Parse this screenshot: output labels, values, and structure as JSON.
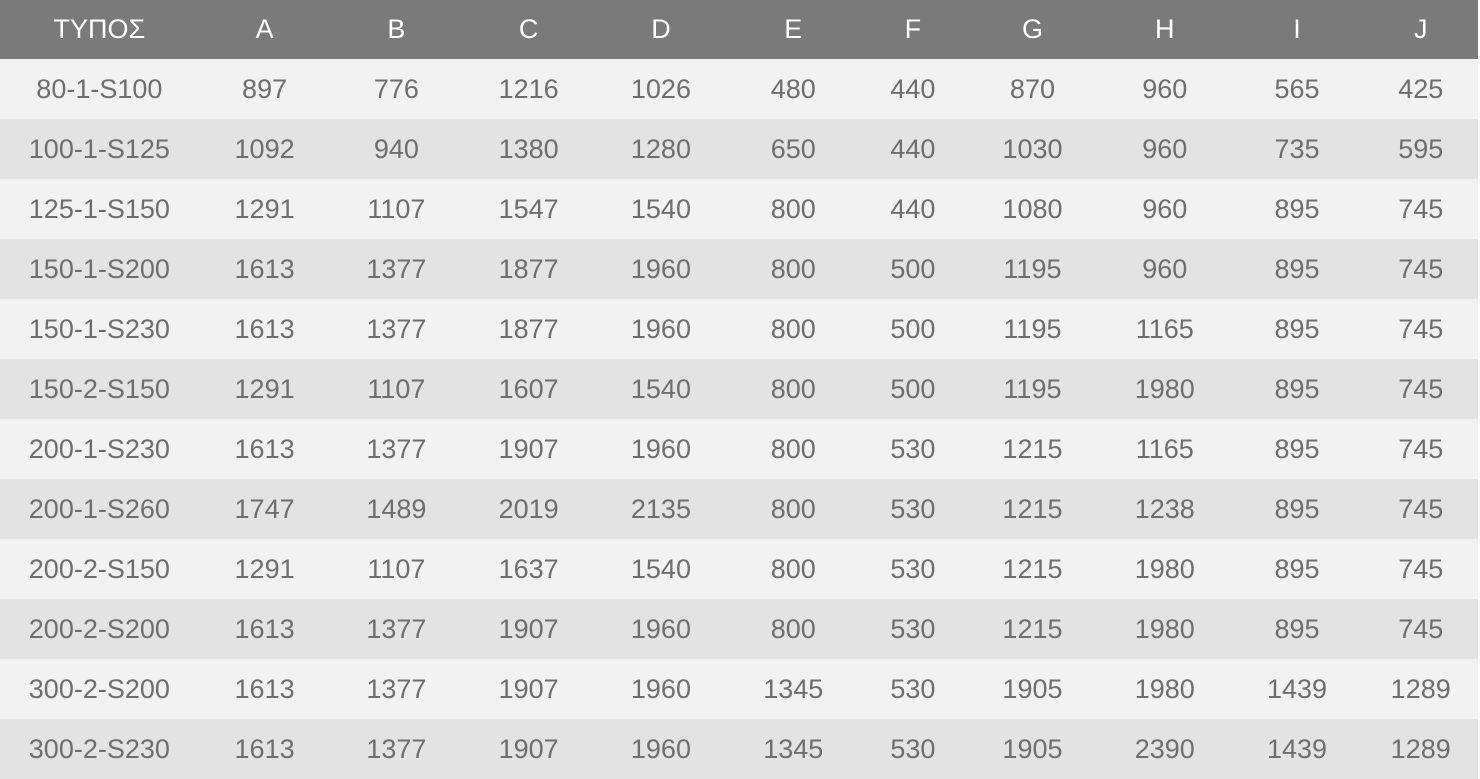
{
  "table": {
    "headers": [
      "ΤΥΠΟΣ",
      "A",
      "B",
      "C",
      "D",
      "E",
      "F",
      "G",
      "H",
      "I",
      "J"
    ],
    "rows": [
      [
        "80-1-S100",
        "897",
        "776",
        "1216",
        "1026",
        "480",
        "440",
        "870",
        "960",
        "565",
        "425"
      ],
      [
        "100-1-S125",
        "1092",
        "940",
        "1380",
        "1280",
        "650",
        "440",
        "1030",
        "960",
        "735",
        "595"
      ],
      [
        "125-1-S150",
        "1291",
        "1107",
        "1547",
        "1540",
        "800",
        "440",
        "1080",
        "960",
        "895",
        "745"
      ],
      [
        "150-1-S200",
        "1613",
        "1377",
        "1877",
        "1960",
        "800",
        "500",
        "1195",
        "960",
        "895",
        "745"
      ],
      [
        "150-1-S230",
        "1613",
        "1377",
        "1877",
        "1960",
        "800",
        "500",
        "1195",
        "1165",
        "895",
        "745"
      ],
      [
        "150-2-S150",
        "1291",
        "1107",
        "1607",
        "1540",
        "800",
        "500",
        "1195",
        "1980",
        "895",
        "745"
      ],
      [
        "200-1-S230",
        "1613",
        "1377",
        "1907",
        "1960",
        "800",
        "530",
        "1215",
        "1165",
        "895",
        "745"
      ],
      [
        "200-1-S260",
        "1747",
        "1489",
        "2019",
        "2135",
        "800",
        "530",
        "1215",
        "1238",
        "895",
        "745"
      ],
      [
        "200-2-S150",
        "1291",
        "1107",
        "1637",
        "1540",
        "800",
        "530",
        "1215",
        "1980",
        "895",
        "745"
      ],
      [
        "200-2-S200",
        "1613",
        "1377",
        "1907",
        "1960",
        "800",
        "530",
        "1215",
        "1980",
        "895",
        "745"
      ],
      [
        "300-2-S200",
        "1613",
        "1377",
        "1907",
        "1960",
        "1345",
        "530",
        "1905",
        "1980",
        "1439",
        "1289"
      ],
      [
        "300-2-S230",
        "1613",
        "1377",
        "1907",
        "1960",
        "1345",
        "530",
        "1905",
        "2390",
        "1439",
        "1289"
      ]
    ]
  },
  "colors": {
    "header_bg": "#7a7a7a",
    "header_text": "#ffffff",
    "row_light": "#f2f2f2",
    "row_dark": "#e3e3e3",
    "cell_text": "#6e6e6e"
  }
}
